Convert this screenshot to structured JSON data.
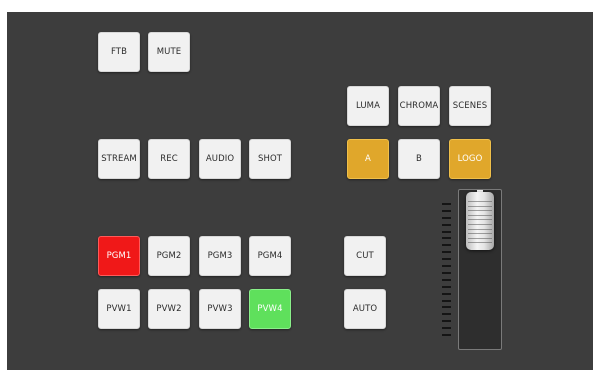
{
  "top_controls": {
    "ftb_label": "FTB",
    "mute_label": "MUTE"
  },
  "key_types": {
    "luma_label": "LUMA",
    "chroma_label": "CHROMA",
    "scenes_label": "SCENES"
  },
  "output_controls": {
    "stream_label": "STREAM",
    "rec_label": "REC",
    "audio_label": "AUDIO",
    "shot_label": "SHOT"
  },
  "overlay_controls": {
    "a_label": "A",
    "b_label": "B",
    "logo_label": "LOGO",
    "a_active": true,
    "b_active": false,
    "logo_active": true
  },
  "program_bus": {
    "buttons": [
      "PGM1",
      "PGM2",
      "PGM3",
      "PGM4"
    ],
    "active_index": 0
  },
  "preview_bus": {
    "buttons": [
      "PVW1",
      "PVW2",
      "PVW3",
      "PVW4"
    ],
    "active_index": 3
  },
  "transition_controls": {
    "cut_label": "CUT",
    "auto_label": "AUTO"
  },
  "t_bar": {
    "position": 1.0
  },
  "colors": {
    "panel_background": "#3d3d3d",
    "button_default": "#f1f1f1",
    "overlay_active": "#e0a72b",
    "program_active": "#f01818",
    "preview_active": "#5fe05c"
  }
}
